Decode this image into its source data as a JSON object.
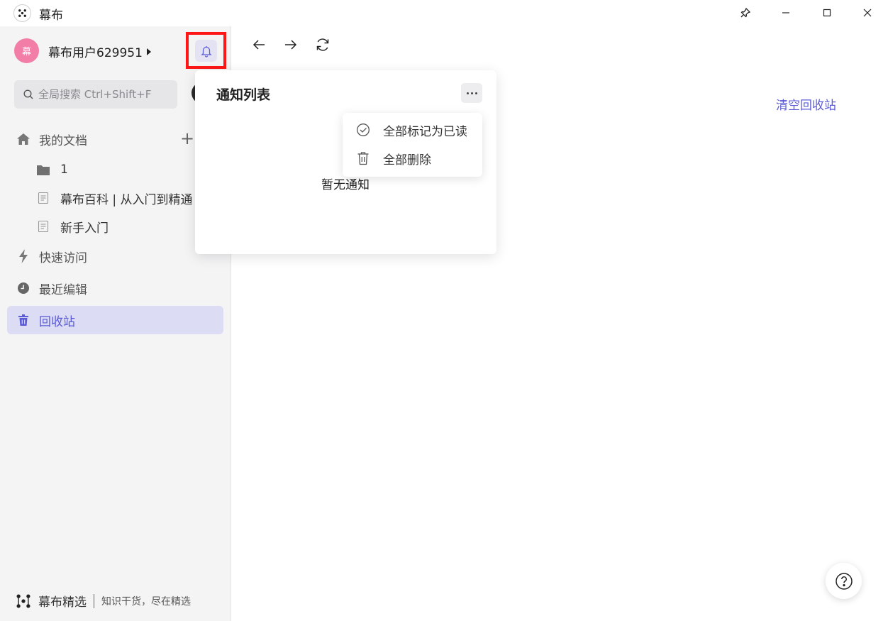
{
  "window": {
    "title": "幕布"
  },
  "user": {
    "avatar_text": "幕",
    "name": "幕布用户629951"
  },
  "search": {
    "placeholder": "全局搜索 Ctrl+Shift+F"
  },
  "sidebar": {
    "my_docs": {
      "label": "我的文档",
      "icon": "home-icon"
    },
    "docs": [
      {
        "label": "1",
        "icon": "folder-icon"
      },
      {
        "label": "幕布百科 | 从入门到精通",
        "icon": "document-icon"
      },
      {
        "label": "新手入门",
        "icon": "document-icon"
      }
    ],
    "quick_access": {
      "label": "快速访问",
      "icon": "lightning-icon"
    },
    "recent": {
      "label": "最近编辑",
      "icon": "clock-icon"
    },
    "trash": {
      "label": "回收站",
      "icon": "trash-icon"
    },
    "footer": {
      "brand": "幕布精选",
      "slogan": "知识干货，尽在精选"
    }
  },
  "main": {
    "empty_trash_label": "清空回收站"
  },
  "notifications": {
    "title": "通知列表",
    "empty_text": "暂无通知",
    "menu": [
      {
        "label": "全部标记为已读",
        "icon": "check-circle-icon"
      },
      {
        "label": "全部删除",
        "icon": "trash-icon"
      }
    ]
  },
  "colors": {
    "accent": "#5b5bd6",
    "avatar": "#f27da7",
    "highlight": "#ff1616"
  }
}
